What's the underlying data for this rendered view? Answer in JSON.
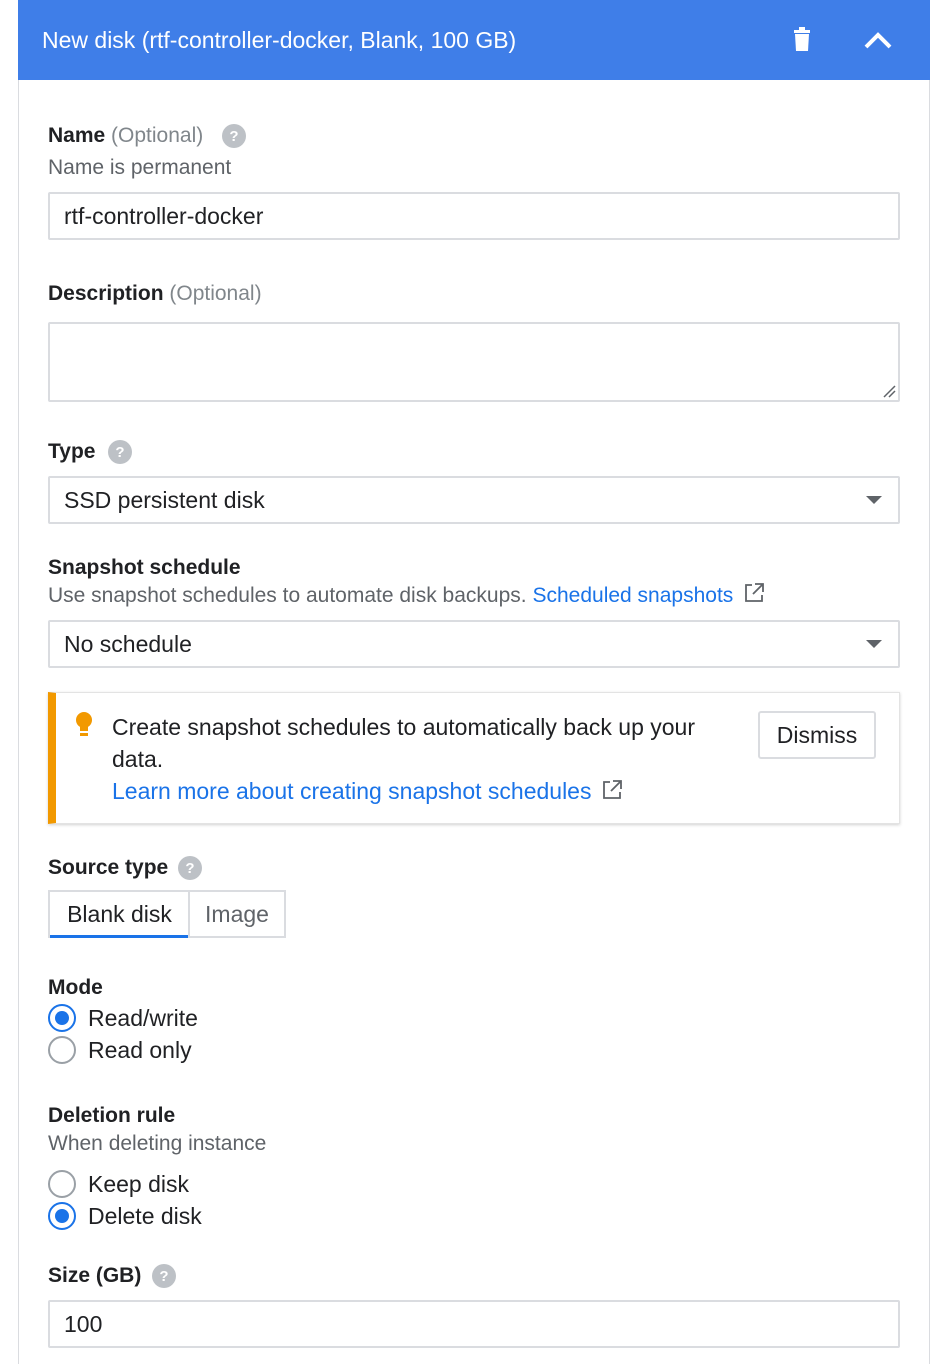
{
  "header": {
    "title": "New disk (rtf-controller-docker, Blank, 100 GB)",
    "background": "#3f7ee8",
    "delete_icon": "trash-icon",
    "collapse_icon": "chevron-up-icon"
  },
  "name": {
    "label": "Name",
    "optional": "(Optional)",
    "note": "Name is permanent",
    "value": "rtf-controller-docker"
  },
  "description": {
    "label": "Description",
    "optional": "(Optional)",
    "value": ""
  },
  "type": {
    "label": "Type",
    "selected": "SSD persistent disk"
  },
  "snapshot_schedule": {
    "label": "Snapshot schedule",
    "hint": "Use snapshot schedules to automate disk backups.",
    "link": "Scheduled snapshots",
    "selected": "No schedule"
  },
  "banner": {
    "text": "Create snapshot schedules to automatically back up your data.",
    "link": "Learn more about creating snapshot schedules",
    "dismiss": "Dismiss",
    "accent": "#f29900"
  },
  "source_type": {
    "label": "Source type",
    "options": [
      "Blank disk",
      "Image"
    ],
    "selected": "Blank disk"
  },
  "mode": {
    "label": "Mode",
    "options": [
      "Read/write",
      "Read only"
    ],
    "selected": "Read/write"
  },
  "deletion_rule": {
    "label": "Deletion rule",
    "hint": "When deleting instance",
    "options": [
      "Keep disk",
      "Delete disk"
    ],
    "selected": "Delete disk"
  },
  "size": {
    "label": "Size (GB)",
    "value": "100"
  },
  "colors": {
    "accent_blue": "#1a73e8",
    "warning": "#f29900"
  }
}
